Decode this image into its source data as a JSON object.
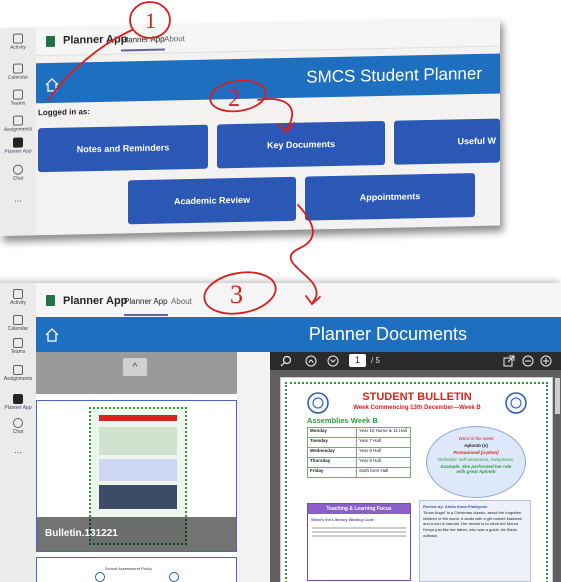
{
  "rail": {
    "items": [
      {
        "label": "Activity"
      },
      {
        "label": "Calendar"
      },
      {
        "label": "Teams"
      },
      {
        "label": "Assignments"
      },
      {
        "label": "Planner App"
      },
      {
        "label": "Chat"
      },
      {
        "label": "..."
      }
    ]
  },
  "app": {
    "title": "Planner App",
    "tabs": [
      {
        "label": "Planner App"
      },
      {
        "label": "About"
      }
    ]
  },
  "planner": {
    "title": "SMCS Student Planner",
    "logged_in_label": "Logged in as:",
    "buttons": [
      {
        "label": "Notes and Reminders"
      },
      {
        "label": "Key Documents"
      },
      {
        "label": "Useful W"
      },
      {
        "label": "Academic Review"
      },
      {
        "label": "Appointments"
      }
    ]
  },
  "documents": {
    "title": "Planner Documents",
    "doc1_label": "Bulletin.131221",
    "doc2_title": "School Assessment Policy",
    "chevron": "^"
  },
  "viewer": {
    "page": "1",
    "total": "/ 5",
    "bulletin_title": "STUDENT BULLETIN",
    "bulletin_subtitle": "Week Commencing 13th December—Week B",
    "assemblies_heading": "Assemblies Week B",
    "assemblies": [
      {
        "day": "Monday",
        "place": "Year 10 Hume & 11 Hall"
      },
      {
        "day": "Tuesday",
        "place": "Year 7 Hall"
      },
      {
        "day": "Wednesday",
        "place": "Year 8 Hall"
      },
      {
        "day": "Thursday",
        "place": "Year 9 Hall"
      },
      {
        "day": "Friday",
        "place": "Sixth form Hall"
      }
    ],
    "word_of_week": "Word of the week",
    "word": "Aplomb (n)",
    "pronounced": "Pronounced [a-plom]",
    "definition": "Definition: self-assurance, composure.",
    "example": "Example: She performed her role with great Aplomb",
    "teaching_heading": "Teaching & Learning Focus",
    "review_heading": "Review by: Aisha Anna Prathyush",
    "review_text": "'Snow Angel' is a Christmas classic, about the forgotten children of the world. It starts with a girl named Madame and a son is hannah. Her dream is to climb the Mount Kenya just like her father, who was a guide. As Slade outback.",
    "learning_sub": "What's the Literacy Waiting Code"
  },
  "annotations": {
    "one": "1",
    "two": "2",
    "three": "3"
  },
  "colors": {
    "brand_blue": "#1e6fbf",
    "button_blue": "#2b58b5",
    "ink_red": "#d42020",
    "bulletin_red": "#d8231c",
    "bulletin_green": "#2e9a3a"
  }
}
